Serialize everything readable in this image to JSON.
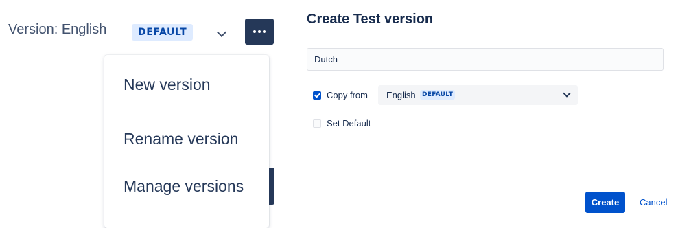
{
  "version_selector": {
    "label": "Version: English",
    "badge": "DEFAULT"
  },
  "actions_menu": {
    "button_icon": "more-horizontal-icon",
    "items": [
      {
        "label": "New version"
      },
      {
        "label": "Rename version"
      },
      {
        "label": "Manage versions"
      }
    ]
  },
  "create_dialog": {
    "title": "Create Test version",
    "name_input": {
      "value": "Dutch"
    },
    "copy_from": {
      "checked": true,
      "label": "Copy from",
      "selected_value": "English",
      "selected_badge": "DEFAULT"
    },
    "set_default": {
      "checked": false,
      "label": "Set Default"
    },
    "create_label": "Create",
    "cancel_label": "Cancel"
  },
  "colors": {
    "primary": "#0052cc",
    "dark_button": "#253858",
    "badge_bg": "#deebff",
    "badge_text": "#0747a6"
  }
}
